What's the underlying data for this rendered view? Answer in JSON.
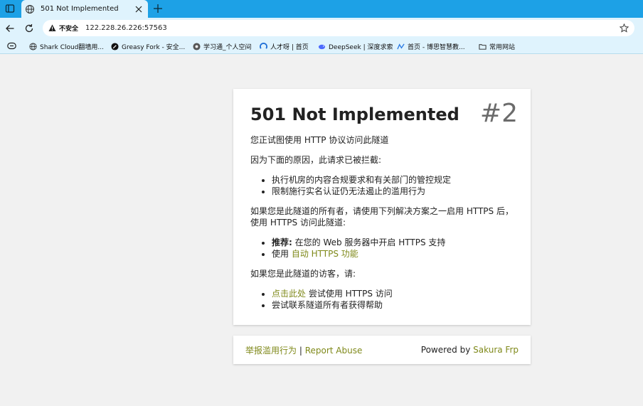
{
  "browser": {
    "tab": {
      "title": "501 Not Implemented"
    },
    "address": {
      "security_label": "不安全",
      "url": "122.228.26.226:57563"
    },
    "bookmarks": [
      {
        "label": "Shark Cloud翻墙用..."
      },
      {
        "label": "Greasy Fork - 安全..."
      },
      {
        "label": "学习通_个人空间"
      },
      {
        "label": "人才呀 | 首页"
      },
      {
        "label": "DeepSeek | 深度求索"
      },
      {
        "label": "首页 - 博思智慧教..."
      },
      {
        "label": "常用网站"
      }
    ]
  },
  "page": {
    "badge": "#2",
    "title": "501 Not Implemented",
    "intro": "您正试图使用 HTTP 协议访问此隧道",
    "reason_heading": "因为下面的原因，此请求已被拦截:",
    "reasons": [
      "执行机房的内容合规要求和有关部门的管控规定",
      "限制施行实名认证仍无法遏止的滥用行为"
    ],
    "owner_heading": "如果您是此隧道的所有者，请使用下列解决方案之一启用 HTTPS 后，使用 HTTPS 访问此隧道:",
    "owner_solutions": [
      {
        "strong": "推荐:",
        "text": " 在您的 Web 服务器中开启 HTTPS 支持"
      },
      {
        "prefix": "使用 ",
        "link": "自动 HTTPS 功能"
      }
    ],
    "visitor_heading": "如果您是此隧道的访客，请:",
    "visitor_solutions": [
      {
        "link": "点击此处",
        "text": " 尝试使用 HTTPS 访问"
      },
      {
        "text": "尝试联系隧道所有者获得帮助"
      }
    ],
    "footer": {
      "report_cn": "举报滥用行为",
      "separator": " | ",
      "report_en": "Report Abuse",
      "powered_by": "Powered by ",
      "brand": "Sakura Frp"
    }
  },
  "colors": {
    "link": "#7f891a",
    "chrome": "#1da1e6",
    "toolbar": "#dff3fd"
  }
}
